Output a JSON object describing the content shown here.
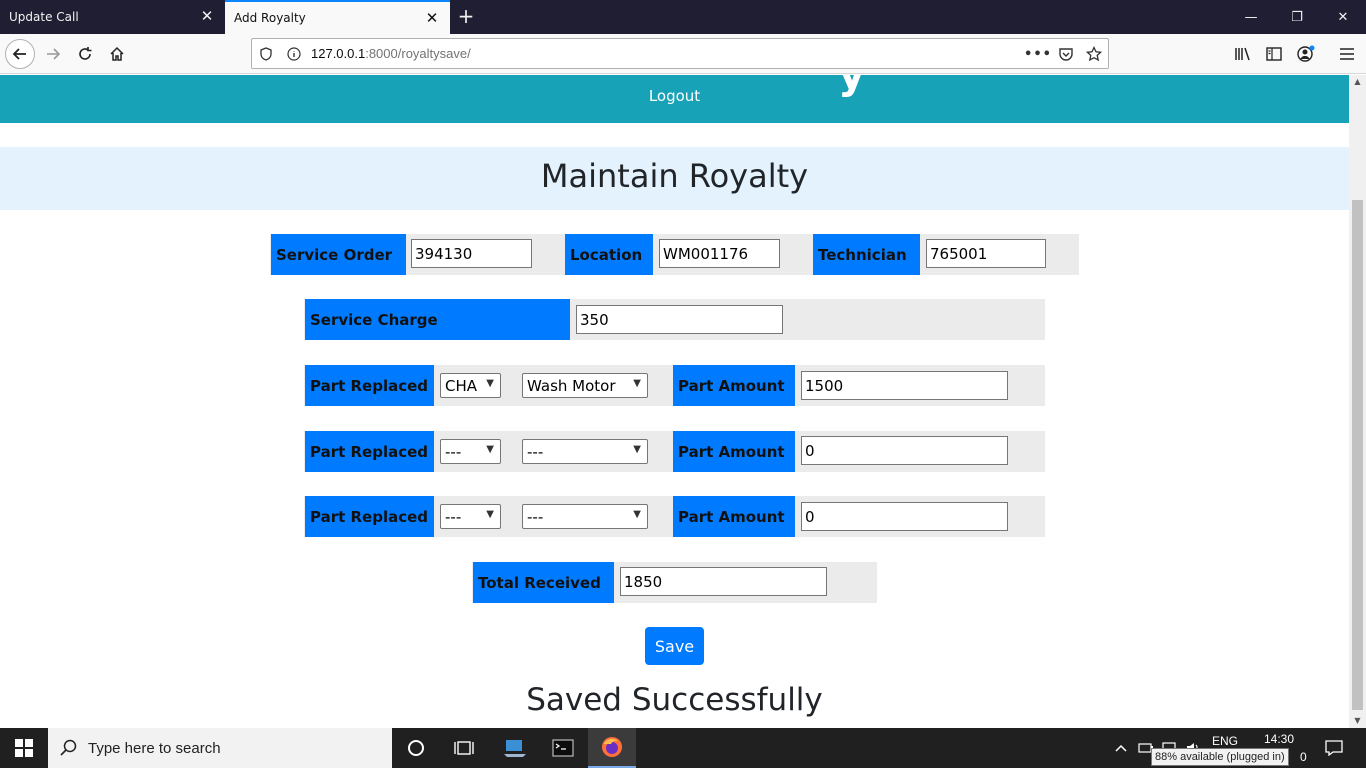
{
  "browser": {
    "tabs": [
      {
        "label": "Update Call",
        "active": false
      },
      {
        "label": "Add Royalty",
        "active": true
      }
    ],
    "url_host": "127.0.0.1",
    "url_rest": ":8000/royaltysave/",
    "url_more": "•••"
  },
  "page": {
    "logout": "Logout",
    "heading": "Maintain Royalty",
    "service_order": {
      "label": "Service Order",
      "value": "394130"
    },
    "location": {
      "label": "Location",
      "value": "WM001176"
    },
    "technician": {
      "label": "Technician",
      "value": "765001"
    },
    "service_charge": {
      "label": "Service Charge",
      "value": "350"
    },
    "parts": [
      {
        "label": "Part Replaced",
        "code": "CHA",
        "part": "Wash Motor",
        "amount_label": "Part Amount",
        "amount": "1500"
      },
      {
        "label": "Part Replaced",
        "code": "---",
        "part": "---",
        "amount_label": "Part Amount",
        "amount": "0"
      },
      {
        "label": "Part Replaced",
        "code": "---",
        "part": "---",
        "amount_label": "Part Amount",
        "amount": "0"
      }
    ],
    "total_received": {
      "label": "Total Received",
      "value": "1850"
    },
    "save_label": "Save",
    "status_message": "Saved Successfully"
  },
  "taskbar": {
    "search_placeholder": "Type here to search",
    "language": "ENG",
    "time": "14:30",
    "tooltip": "88% available (plugged in)",
    "date_fragment": "0"
  },
  "colors": {
    "banner": "#17a2b8",
    "label_bg": "#007bff",
    "heading_band": "#e3f2fd"
  }
}
